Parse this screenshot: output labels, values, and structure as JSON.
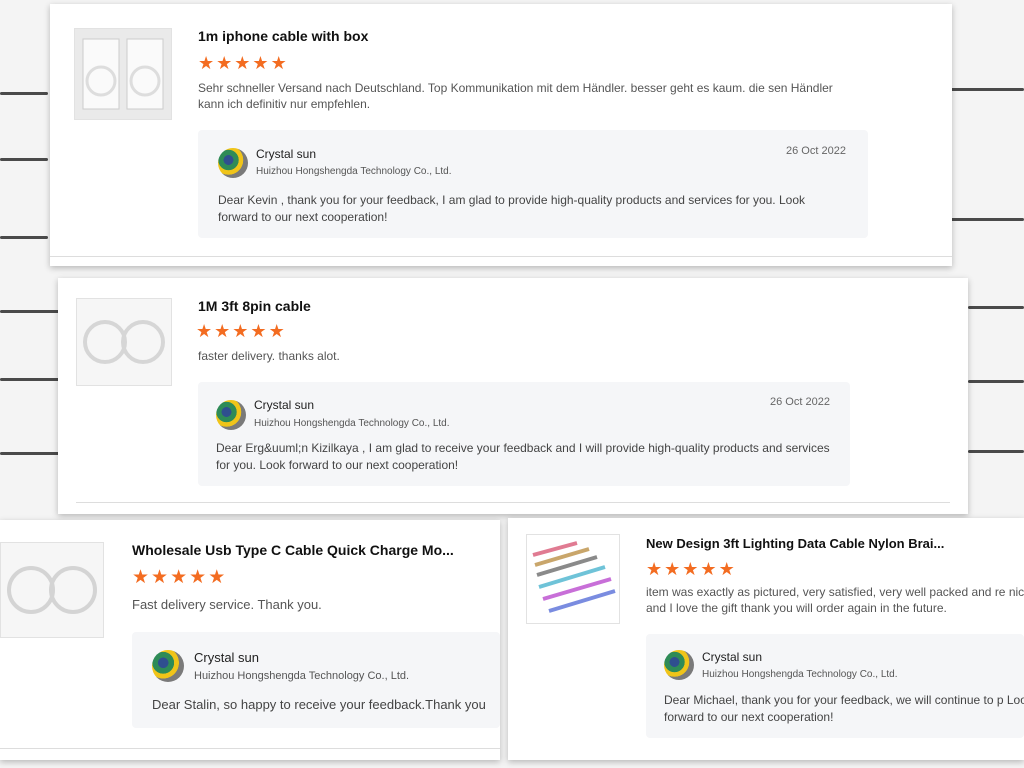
{
  "reviews": [
    {
      "product": "1m iphone cable with box",
      "stars": 5,
      "review": "Sehr schneller Versand nach Deutschland. Top Kommunikation mit dem Händler. besser geht es kaum. die sen Händler kann ich definitiv nur empfehlen.",
      "reply_author": "Crystal sun",
      "reply_company": "Huizhou Hongshengda Technology Co., Ltd.",
      "reply_date": "26 Oct 2022",
      "reply_text": "Dear Kevin , thank you for your feedback, I am glad to provide high-quality products and services for you. Look forward to our next cooperation!"
    },
    {
      "product": "1M 3ft 8pin cable",
      "stars": 5,
      "review": "faster delivery. thanks alot.",
      "reply_author": "Crystal sun",
      "reply_company": "Huizhou Hongshengda Technology Co., Ltd.",
      "reply_date": "26 Oct 2022",
      "reply_text": "Dear Erg&uuml;n Kizilkaya ,  I am glad to receive your feedback and I will provide high-quality products and services for you. Look forward to our next cooperation!"
    },
    {
      "product": "Wholesale Usb Type C Cable Quick Charge Mo...",
      "stars": 5,
      "review": "Fast delivery service. Thank you.",
      "reply_author": "Crystal sun",
      "reply_company": "Huizhou Hongshengda Technology Co., Ltd.",
      "reply_date": "",
      "reply_text": "Dear Stalin, so happy to receive your feedback.Thank you"
    },
    {
      "product": "New Design 3ft Lighting Data Cable Nylon Brai...",
      "stars": 5,
      "review": "item was exactly as pictured, very satisfied, very well packed and re nice and I love the gift thank you will order again in the future.",
      "reply_author": "Crystal sun",
      "reply_company": "Huizhou Hongshengda Technology Co., Ltd.",
      "reply_date": "",
      "reply_text": "Dear Michael, thank you for your feedback, we will continue to p Look forward to our next cooperation!"
    }
  ],
  "colors": {
    "star": "#f36c21",
    "reply_bg": "#f5f6f8"
  },
  "icons": {
    "star": "star-icon",
    "avatar": "avatar-image",
    "product": "cable-product-image"
  }
}
